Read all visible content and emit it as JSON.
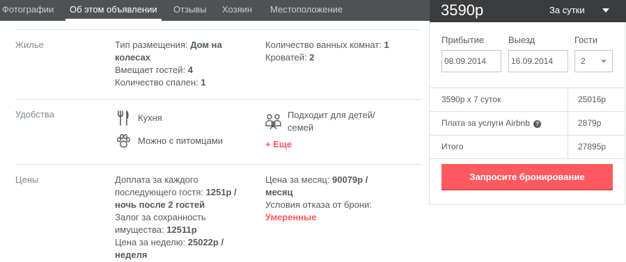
{
  "nav": {
    "tabs": [
      {
        "label": "Фотографии"
      },
      {
        "label": "Об этом объявлении"
      },
      {
        "label": "Отзывы"
      },
      {
        "label": "Хозяин"
      },
      {
        "label": "Местоположение"
      }
    ],
    "active_index": 1
  },
  "booking": {
    "price": "3590р",
    "per": "За сутки",
    "checkin_label": "Прибытие",
    "checkin_value": "08.09.2014",
    "checkout_label": "Выезд",
    "checkout_value": "16.09.2014",
    "guests_label": "Гости",
    "guests_value": "2",
    "rows": [
      {
        "label": "3590р x 7 суток",
        "value": "25016р"
      },
      {
        "label": "Плата за услуги Airbnb",
        "value": "2879р"
      },
      {
        "label": "Итого",
        "value": "27895р"
      }
    ],
    "help_icon_glyph": "?",
    "button": "Запросите бронирование",
    "accent_color": "#ff5a5f"
  },
  "housing": {
    "label": "Жилье",
    "type_label": "Тип размещения: ",
    "type_value_1": "Дом на",
    "type_value_2": "колесах",
    "guests_label": "Вмещает гостей: ",
    "guests_value": "4",
    "bedrooms_label": "Количество спален: ",
    "bedrooms_value": "1",
    "bathrooms_label": "Количество ванных комнат: ",
    "bathrooms_value": "1",
    "beds_label": "Кроватей: ",
    "beds_value": "2"
  },
  "amenities": {
    "label": "Удобства",
    "kitchen": "Кухня",
    "pets": "Можно с питомцами",
    "family_1": "Подходит для детей/",
    "family_2": "семей",
    "more": "+ Еще"
  },
  "prices": {
    "label": "Цены",
    "extra_1": "Доплата за каждого",
    "extra_2": "последующего гостя: ",
    "extra_value": "1251р /",
    "extra_3": "ночь после 2 гостей",
    "deposit_1": "Залог за сохранность",
    "deposit_2": "имущества: ",
    "deposit_value": "12511р",
    "weekly_label": "Цена за неделю: ",
    "weekly_value": "25022р /",
    "weekly_unit": "неделя",
    "monthly_label": "Цена за месяц: ",
    "monthly_value": "90079р /",
    "monthly_unit": "месяц",
    "cancel_label": "Условия отказа от брони:",
    "cancel_value": "Умеренные"
  }
}
